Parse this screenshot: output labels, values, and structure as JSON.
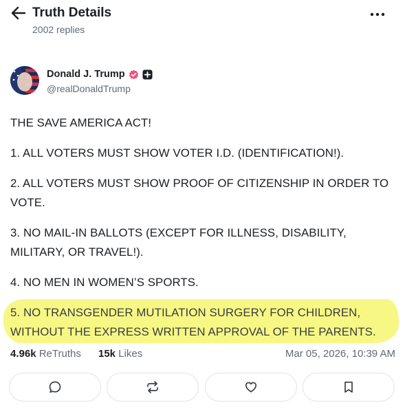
{
  "header": {
    "title": "Truth Details",
    "replies": "2002 replies",
    "back_icon": "arrow-left-icon",
    "more_icon": "more-horizontal-icon"
  },
  "author": {
    "name": "Donald J. Trump",
    "handle": "@realDonaldTrump",
    "verified_color": "#e9577f"
  },
  "post": {
    "paragraphs": [
      "THE SAVE AMERICA ACT!",
      "1. ALL VOTERS MUST SHOW VOTER I.D. (IDENTIFICATION!).",
      "2. ALL VOTERS MUST SHOW PROOF OF CITIZENSHIP IN ORDER TO VOTE.",
      "3. NO MAIL-IN BALLOTS (EXCEPT FOR ILLNESS, DISABILITY, MILITARY, OR TRAVEL!).",
      "4. NO MEN IN WOMEN’S SPORTS."
    ],
    "highlighted_paragraph": "5. NO TRANSGENDER MUTILATION SURGERY FOR CHILDREN, WITHOUT THE EXPRESS WRITTEN APPROVAL OF THE PARENTS.",
    "highlight_color": "#f6f76f"
  },
  "stats": {
    "retruths_count": "4.96k",
    "retruths_label": "ReTruths",
    "likes_count": "15k",
    "likes_label": "Likes",
    "date": "Mar 05, 2026, 10:39 AM"
  },
  "actions": [
    "reply-icon",
    "retruth-icon",
    "like-icon",
    "bookmark-icon"
  ]
}
